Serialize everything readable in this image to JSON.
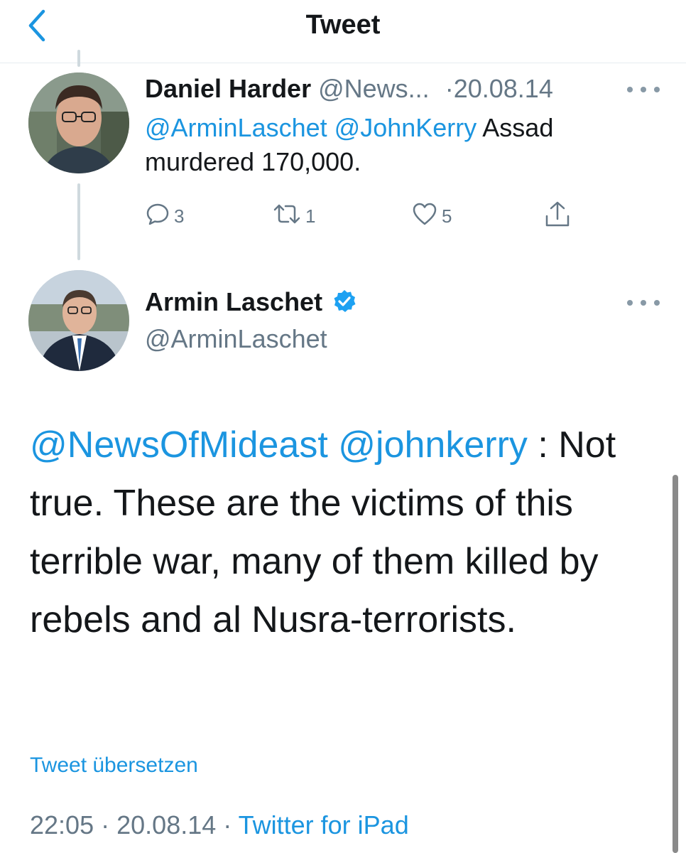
{
  "header": {
    "title": "Tweet"
  },
  "reply_tweet": {
    "display_name": "Daniel Harder",
    "handle": "@News...",
    "separator": "·",
    "date": "20.08.14",
    "mentions": "@ArminLaschet @JohnKerry",
    "text_after_mentions": "Assad",
    "text_line2": "murdered 170,000.",
    "actions": {
      "replies": "3",
      "retweets": "1",
      "likes": "5"
    }
  },
  "main_tweet": {
    "display_name": "Armin Laschet",
    "handle": "@ArminLaschet",
    "verified": true,
    "mentions": "@NewsOfMideast @johnkerry",
    "mention_suffix": ":",
    "text": "Not true. These are the victims of this terrible war, many of them killed by rebels and al Nusra-terrorists.",
    "translate_label": "Tweet übersetzen",
    "time": "22:05",
    "date": "20.08.14",
    "meta_sep": "·",
    "source": "Twitter for iPad"
  },
  "colors": {
    "accent": "#1b95e0",
    "muted": "#657786",
    "text": "#14171a",
    "verified": "#1da1f2"
  }
}
